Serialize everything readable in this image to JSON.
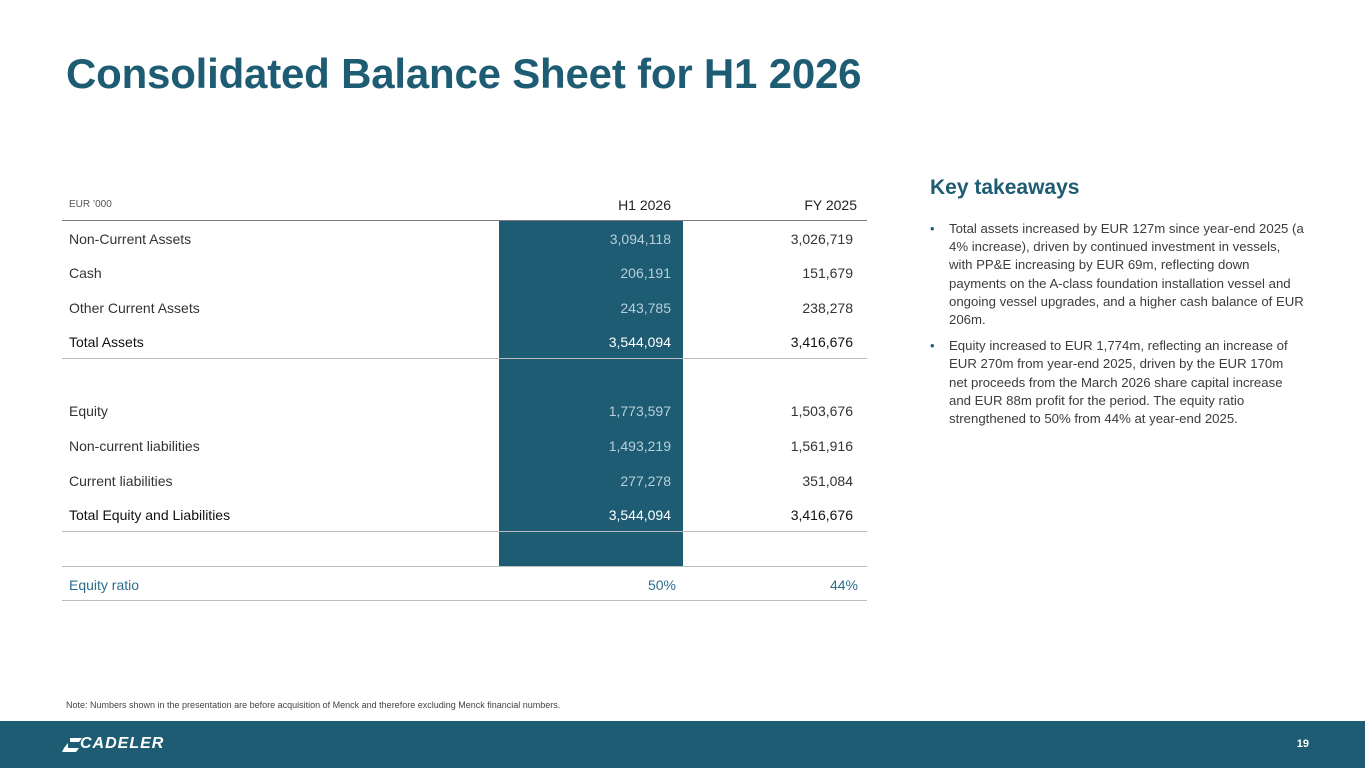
{
  "title": "Consolidated Balance Sheet for H1 2026",
  "table": {
    "unit": "EUR ’000",
    "col_h1": "H1 2026",
    "col_fy": "FY 2025",
    "rows": [
      {
        "label": "Non-Current Assets",
        "h1": "3,094,118",
        "fy": "3,026,719"
      },
      {
        "label": "Cash",
        "h1": "206,191",
        "fy": "151,679"
      },
      {
        "label": "Other Current Assets",
        "h1": "243,785",
        "fy": "238,278"
      },
      {
        "label": "Total Assets",
        "h1": "3,544,094",
        "fy": "3,416,676"
      },
      {
        "label": "Equity",
        "h1": "1,773,597",
        "fy": "1,503,676"
      },
      {
        "label": "Non-current liabilities",
        "h1": "1,493,219",
        "fy": "1,561,916"
      },
      {
        "label": "Current liabilities",
        "h1": "277,278",
        "fy": "351,084"
      },
      {
        "label": "Total Equity and Liabilities",
        "h1": "3,544,094",
        "fy": "3,416,676"
      },
      {
        "label": "Equity ratio",
        "h1": "50%",
        "fy": "44%"
      }
    ]
  },
  "takeaways": {
    "title": "Key takeaways",
    "bullets": [
      "Total assets increased by EUR 127m since year-end 2025 (a 4% increase), driven by continued investment in vessels, with PP&E increasing by EUR 69m, reflecting down payments on the A-class foundation installation vessel and ongoing vessel upgrades, and a higher cash balance of EUR 206m.",
      "Equity increased to EUR 1,774m, reflecting an increase of EUR 270m from year-end 2025, driven by the EUR 170m net proceeds from the March 2026 share capital increase and EUR 88m profit for the period. The equity ratio strengthened to 50% from 44% at year-end 2025."
    ]
  },
  "note": "Note: Numbers shown in the presentation are before acquisition of Menck and therefore excluding Menck financial numbers.",
  "footer": {
    "logo": "CADELER",
    "page_number": "19"
  },
  "colors": {
    "brand": "#1e5c74",
    "ratio_text": "#2c6e8e"
  }
}
